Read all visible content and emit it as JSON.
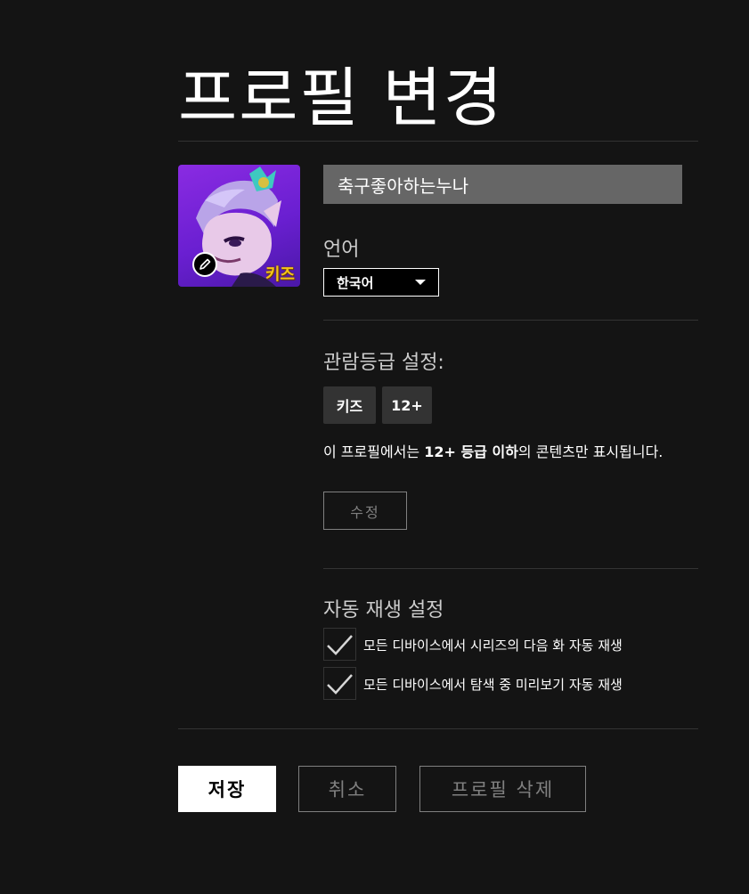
{
  "page": {
    "title": "프로필 변경"
  },
  "profile": {
    "name": "축구좋아하는누나",
    "avatar_badge": "키즈",
    "edit_icon": "pencil-icon"
  },
  "language": {
    "label": "언어",
    "selected": "한국어",
    "icon": "caret-down-icon"
  },
  "maturity": {
    "label": "관람등급 설정:",
    "chips": [
      "키즈",
      "12+"
    ],
    "desc_prefix": "이 프로필에서는 ",
    "desc_bold1": "12+ 등급 이하",
    "desc_suffix": "의 콘텐츠만 표시됩니다.",
    "edit_label": "수정"
  },
  "autoplay": {
    "label": "자동 재생 설정",
    "options": [
      {
        "label": "모든 디바이스에서 시리즈의 다음 화 자동 재생",
        "checked": true
      },
      {
        "label": "모든 디바이스에서 탐색 중 미리보기 자동 재생",
        "checked": true
      }
    ]
  },
  "actions": {
    "save": "저장",
    "cancel": "취소",
    "delete": "프로필 삭제"
  },
  "colors": {
    "background": "#141414",
    "input_bg": "#666666",
    "chip_bg": "#333333",
    "muted": "#808080",
    "kids_badge": "#f5c518"
  }
}
